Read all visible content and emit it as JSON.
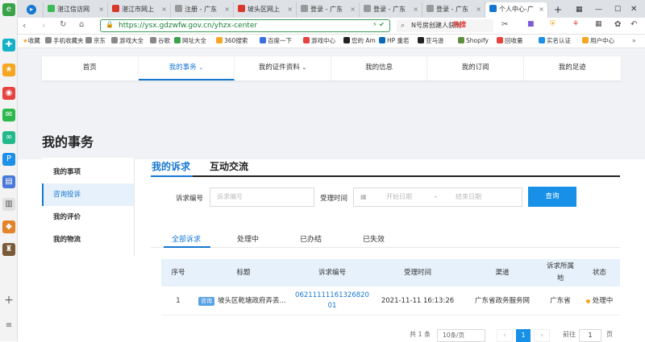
{
  "browser": {
    "tabs": [
      {
        "label": "湛江信访网",
        "color": "#3cba54"
      },
      {
        "label": "湛江市网上",
        "color": "#d8372b"
      },
      {
        "label": "注册 - 广东",
        "color": "#999999"
      },
      {
        "label": "坡头区网上",
        "color": "#d8372b"
      },
      {
        "label": "登录 - 广东",
        "color": "#999999"
      },
      {
        "label": "登录 - 广东",
        "color": "#999999"
      },
      {
        "label": "登录 - 广东",
        "color": "#999999"
      },
      {
        "label": "个人中心-广",
        "color": "#1677d2"
      }
    ],
    "url": "https://ysx.gdzwfw.gov.cn/yhzx-center",
    "search_placeholder": "N号房创建人获刑",
    "search_hot": "热搜",
    "bookmarks": [
      "收藏",
      "手机收藏夹",
      "京东",
      "游戏大全",
      "谷歌",
      "网址大全",
      "360搜索",
      "百度一下",
      "游戏中心",
      "您的 Am",
      "HP 重若",
      "亚马逊",
      "Shopify",
      "回收量",
      "实名认证",
      "用户中心"
    ]
  },
  "nav": {
    "items": [
      "首页",
      "我的事务",
      "我的证件资料",
      "我的信息",
      "我的订阅",
      "我的足迹"
    ],
    "active_index": 1
  },
  "page_title": "我的事务",
  "sidebar": {
    "items": [
      "我的事项",
      "咨询投诉",
      "我的评价",
      "我的物流"
    ],
    "active_index": 1
  },
  "main_tabs": [
    "我的诉求",
    "互动交流"
  ],
  "filter": {
    "code_label": "诉求编号",
    "code_placeholder": "诉求编号",
    "time_label": "受理时间",
    "start_placeholder": "开始日期",
    "sep": "-",
    "end_placeholder": "结束日期",
    "query_button": "查询"
  },
  "status_tabs": [
    "全部诉求",
    "处理中",
    "已办结",
    "已失效"
  ],
  "table": {
    "headers": [
      "序号",
      "标题",
      "诉求编号",
      "受理时间",
      "渠道",
      "诉求所属地",
      "状态"
    ],
    "rows": [
      {
        "index": "1",
        "tag": "咨询",
        "title": "坡头区乾塘政府弄丢...",
        "code": "06211111161326820 01",
        "time": "2021-11-11 16:13:26",
        "channel": "广东省政务服务网",
        "region": "广东省",
        "status": "处理中"
      }
    ]
  },
  "pagination": {
    "total": "共 1 条",
    "page_size": "10条/页",
    "current": "1",
    "goto": "前往",
    "page_input": "1",
    "page_suffix": "页"
  }
}
